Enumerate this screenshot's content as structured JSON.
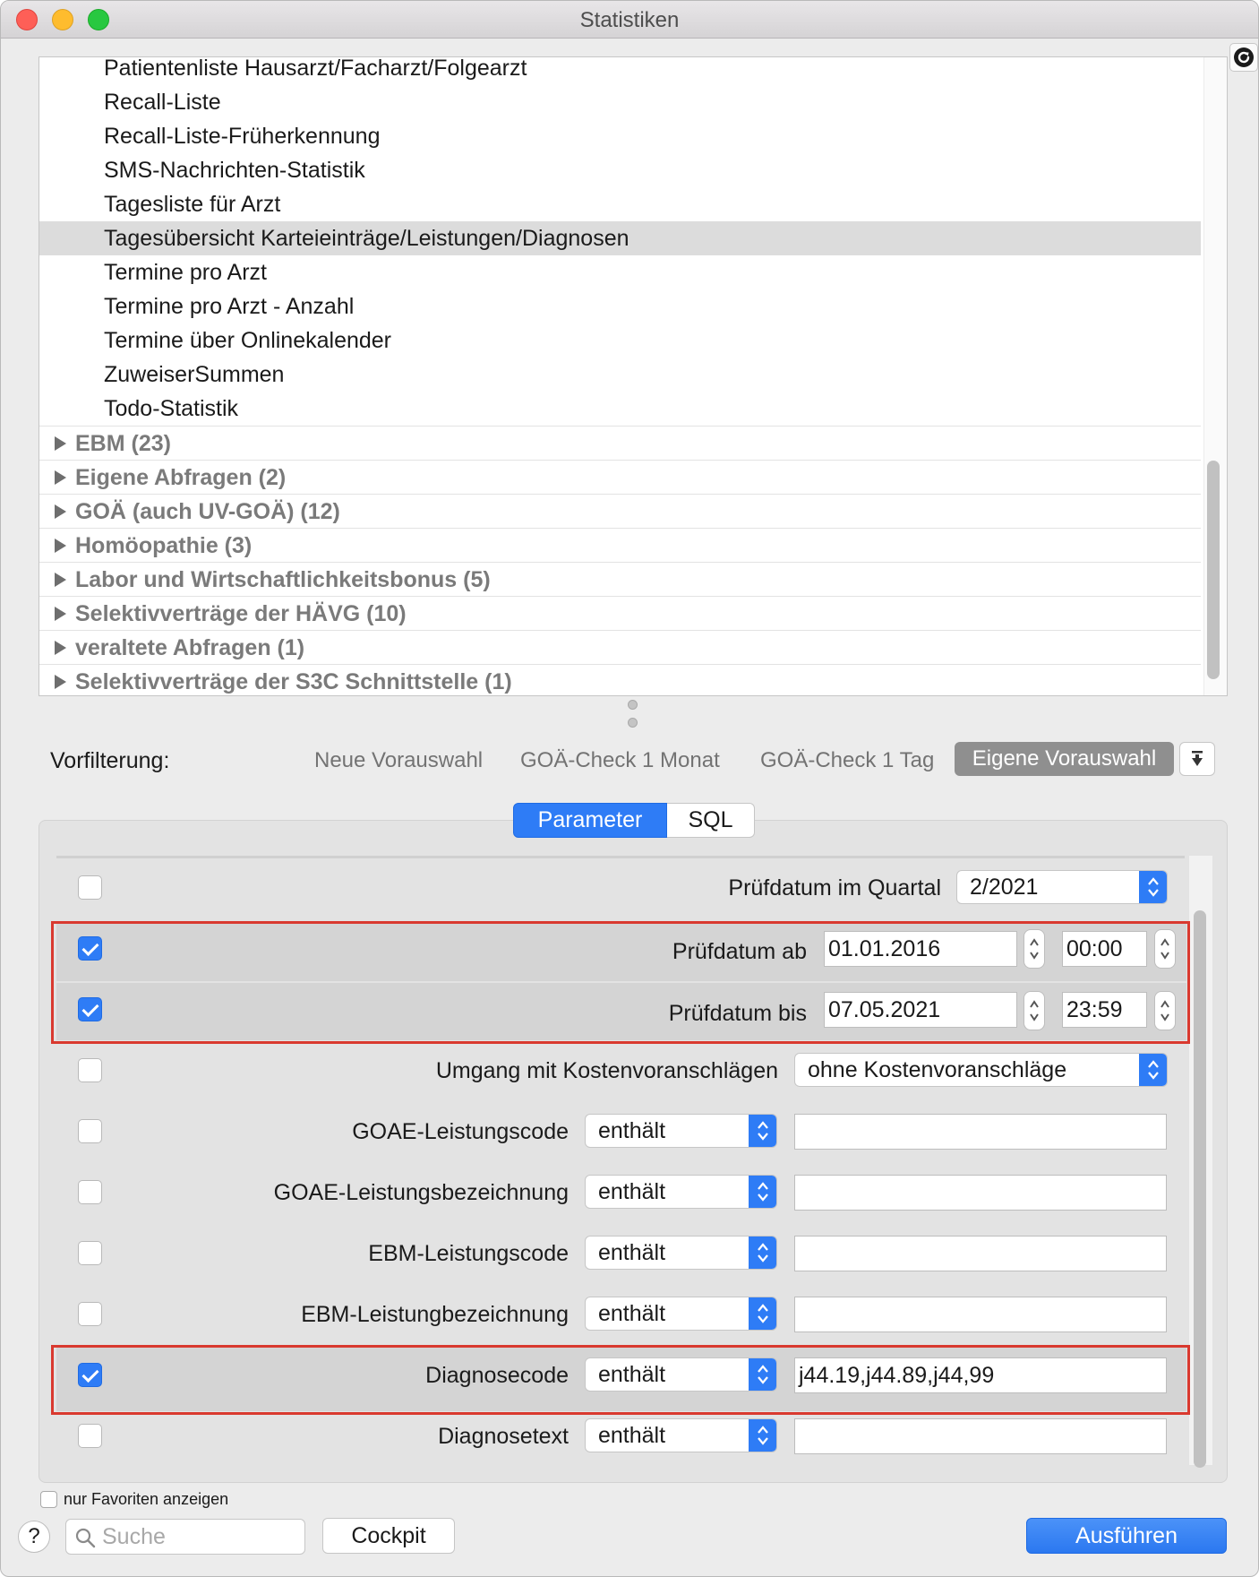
{
  "window": {
    "title": "Statistiken"
  },
  "tree": {
    "items": [
      "Patientenliste Hausarzt/Facharzt/Folgearzt",
      "Recall-Liste",
      "Recall-Liste-Früherkennung",
      "SMS-Nachrichten-Statistik",
      "Tagesliste für Arzt",
      "Tagesübersicht Karteieinträge/Leistungen/Diagnosen",
      "Termine pro Arzt",
      "Termine pro Arzt - Anzahl",
      "Termine über Onlinekalender",
      "ZuweiserSummen",
      "Todo-Statistik"
    ],
    "selected": "Tagesübersicht Karteieinträge/Leistungen/Diagnosen",
    "groups": [
      "EBM (23)",
      "Eigene Abfragen (2)",
      "GOÄ (auch UV-GOÄ) (12)",
      "Homöopathie (3)",
      "Labor und Wirtschaftlichkeitsbonus (5)",
      "Selektivverträge der HÄVG (10)",
      "veraltete Abfragen (1)",
      "Selektivverträge der S3C Schnittstelle (1)"
    ]
  },
  "prefilter": {
    "label": "Vorfilterung:",
    "options": [
      "Neue Vorauswahl",
      "GOÄ-Check 1 Monat",
      "GOÄ-Check 1 Tag"
    ],
    "active": "Eigene Vorauswahl"
  },
  "tabs": {
    "parameter": "Parameter",
    "sql": "SQL",
    "selected": "Parameter"
  },
  "params": {
    "quarter": {
      "label": "Prüfdatum im Quartal",
      "value": "2/2021",
      "checked": false
    },
    "from": {
      "label": "Prüfdatum ab",
      "date": "01.01.2016",
      "time": "00:00",
      "checked": true
    },
    "to": {
      "label": "Prüfdatum bis",
      "date": "07.05.2021",
      "time": "23:59",
      "checked": true
    },
    "cost_estimates": {
      "label": "Umgang mit Kostenvoranschlägen",
      "value": "ohne Kostenvoranschläge",
      "checked": false
    },
    "rows": [
      {
        "label": "GOAE-Leistungscode",
        "operator": "enthält",
        "value": "",
        "checked": false
      },
      {
        "label": "GOAE-Leistungsbezeichnung",
        "operator": "enthält",
        "value": "",
        "checked": false
      },
      {
        "label": "EBM-Leistungscode",
        "operator": "enthält",
        "value": "",
        "checked": false
      },
      {
        "label": "EBM-Leistungbezeichnung",
        "operator": "enthält",
        "value": "",
        "checked": false
      },
      {
        "label": "Diagnosecode",
        "operator": "enthält",
        "value": "j44.19,j44.89,j44,99",
        "checked": true
      },
      {
        "label": "Diagnosetext",
        "operator": "enthält",
        "value": "",
        "checked": false
      }
    ]
  },
  "footer": {
    "favorites_label": "nur Favoriten anzeigen",
    "help": "?",
    "search_placeholder": "Suche",
    "cockpit": "Cockpit",
    "run": "Ausführen"
  },
  "colors": {
    "accent": "#2e7cf6",
    "highlight": "#d9392f",
    "selected_row": "#dcdcdc"
  }
}
